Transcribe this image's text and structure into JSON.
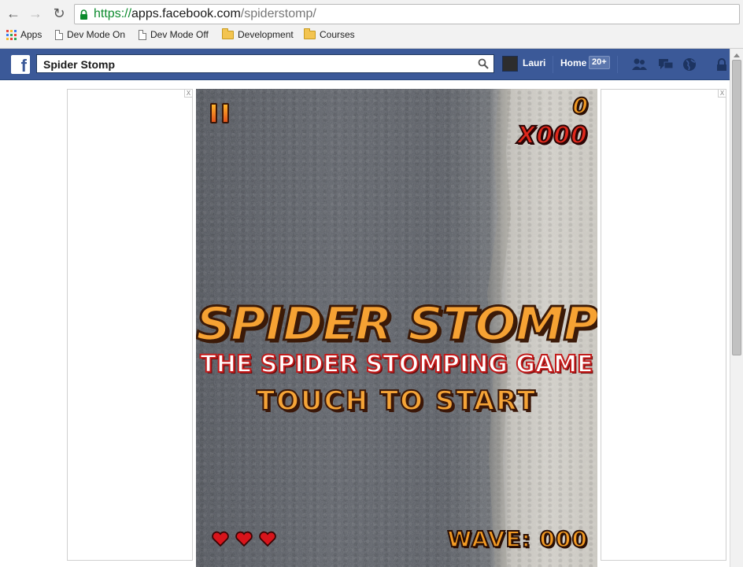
{
  "browser": {
    "url_protocol": "https://",
    "url_host": "apps.facebook.com",
    "url_path": "/spiderstomp/",
    "bookmarks": [
      {
        "label": "Apps",
        "icon": "apps-grid-icon"
      },
      {
        "label": "Dev Mode On",
        "icon": "page-icon"
      },
      {
        "label": "Dev Mode Off",
        "icon": "page-icon"
      },
      {
        "label": "Development",
        "icon": "folder-icon"
      },
      {
        "label": "Courses",
        "icon": "folder-icon"
      }
    ]
  },
  "facebook": {
    "search_value": "Spider Stomp",
    "user_name": "Lauri",
    "home_label": "Home",
    "home_badge": "20+",
    "brand_color": "#3b5998"
  },
  "ads": {
    "close_label": "X"
  },
  "game": {
    "pause_icon": "pause-icon",
    "score": "0",
    "multiplier": "X000",
    "title": "SPIDER STOMP",
    "subtitle": "THE SPIDER STOMPING GAME",
    "prompt": "TOUCH TO START",
    "lives": 3,
    "wave_label": "WAVE: 000"
  }
}
